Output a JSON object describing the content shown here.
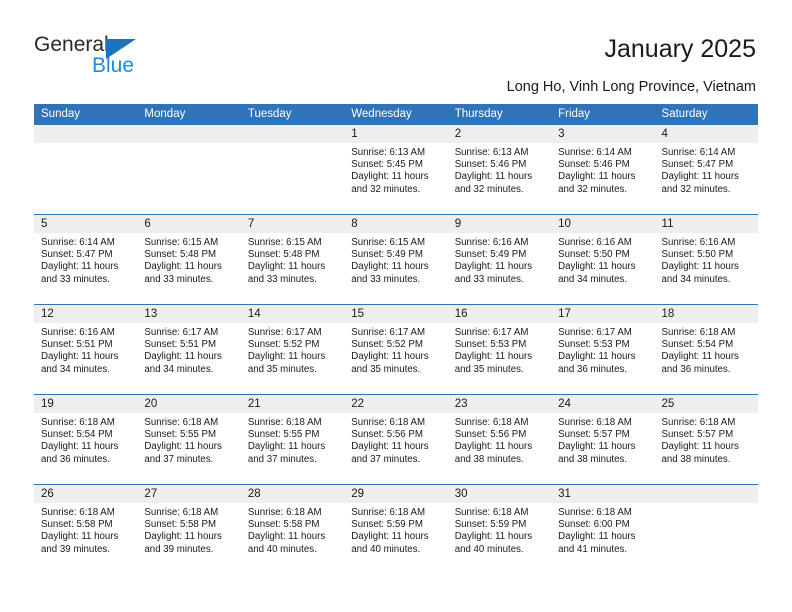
{
  "brand": {
    "name_part1": "General",
    "name_part2": "Blue",
    "triangle_color": "#1b74bb",
    "blue_color": "#1b8ae0"
  },
  "header": {
    "title": "January 2025",
    "subtitle": "Long Ho, Vinh Long Province, Vietnam",
    "accent_color": "#3073b8"
  },
  "calendar": {
    "weekday_headers": [
      "Sunday",
      "Monday",
      "Tuesday",
      "Wednesday",
      "Thursday",
      "Friday",
      "Saturday"
    ],
    "weeks": [
      [
        {
          "day": "",
          "lines": []
        },
        {
          "day": "",
          "lines": []
        },
        {
          "day": "",
          "lines": []
        },
        {
          "day": "1",
          "lines": [
            "Sunrise: 6:13 AM",
            "Sunset: 5:45 PM",
            "Daylight: 11 hours",
            "and 32 minutes."
          ]
        },
        {
          "day": "2",
          "lines": [
            "Sunrise: 6:13 AM",
            "Sunset: 5:46 PM",
            "Daylight: 11 hours",
            "and 32 minutes."
          ]
        },
        {
          "day": "3",
          "lines": [
            "Sunrise: 6:14 AM",
            "Sunset: 5:46 PM",
            "Daylight: 11 hours",
            "and 32 minutes."
          ]
        },
        {
          "day": "4",
          "lines": [
            "Sunrise: 6:14 AM",
            "Sunset: 5:47 PM",
            "Daylight: 11 hours",
            "and 32 minutes."
          ]
        }
      ],
      [
        {
          "day": "5",
          "lines": [
            "Sunrise: 6:14 AM",
            "Sunset: 5:47 PM",
            "Daylight: 11 hours",
            "and 33 minutes."
          ]
        },
        {
          "day": "6",
          "lines": [
            "Sunrise: 6:15 AM",
            "Sunset: 5:48 PM",
            "Daylight: 11 hours",
            "and 33 minutes."
          ]
        },
        {
          "day": "7",
          "lines": [
            "Sunrise: 6:15 AM",
            "Sunset: 5:48 PM",
            "Daylight: 11 hours",
            "and 33 minutes."
          ]
        },
        {
          "day": "8",
          "lines": [
            "Sunrise: 6:15 AM",
            "Sunset: 5:49 PM",
            "Daylight: 11 hours",
            "and 33 minutes."
          ]
        },
        {
          "day": "9",
          "lines": [
            "Sunrise: 6:16 AM",
            "Sunset: 5:49 PM",
            "Daylight: 11 hours",
            "and 33 minutes."
          ]
        },
        {
          "day": "10",
          "lines": [
            "Sunrise: 6:16 AM",
            "Sunset: 5:50 PM",
            "Daylight: 11 hours",
            "and 34 minutes."
          ]
        },
        {
          "day": "11",
          "lines": [
            "Sunrise: 6:16 AM",
            "Sunset: 5:50 PM",
            "Daylight: 11 hours",
            "and 34 minutes."
          ]
        }
      ],
      [
        {
          "day": "12",
          "lines": [
            "Sunrise: 6:16 AM",
            "Sunset: 5:51 PM",
            "Daylight: 11 hours",
            "and 34 minutes."
          ]
        },
        {
          "day": "13",
          "lines": [
            "Sunrise: 6:17 AM",
            "Sunset: 5:51 PM",
            "Daylight: 11 hours",
            "and 34 minutes."
          ]
        },
        {
          "day": "14",
          "lines": [
            "Sunrise: 6:17 AM",
            "Sunset: 5:52 PM",
            "Daylight: 11 hours",
            "and 35 minutes."
          ]
        },
        {
          "day": "15",
          "lines": [
            "Sunrise: 6:17 AM",
            "Sunset: 5:52 PM",
            "Daylight: 11 hours",
            "and 35 minutes."
          ]
        },
        {
          "day": "16",
          "lines": [
            "Sunrise: 6:17 AM",
            "Sunset: 5:53 PM",
            "Daylight: 11 hours",
            "and 35 minutes."
          ]
        },
        {
          "day": "17",
          "lines": [
            "Sunrise: 6:17 AM",
            "Sunset: 5:53 PM",
            "Daylight: 11 hours",
            "and 36 minutes."
          ]
        },
        {
          "day": "18",
          "lines": [
            "Sunrise: 6:18 AM",
            "Sunset: 5:54 PM",
            "Daylight: 11 hours",
            "and 36 minutes."
          ]
        }
      ],
      [
        {
          "day": "19",
          "lines": [
            "Sunrise: 6:18 AM",
            "Sunset: 5:54 PM",
            "Daylight: 11 hours",
            "and 36 minutes."
          ]
        },
        {
          "day": "20",
          "lines": [
            "Sunrise: 6:18 AM",
            "Sunset: 5:55 PM",
            "Daylight: 11 hours",
            "and 37 minutes."
          ]
        },
        {
          "day": "21",
          "lines": [
            "Sunrise: 6:18 AM",
            "Sunset: 5:55 PM",
            "Daylight: 11 hours",
            "and 37 minutes."
          ]
        },
        {
          "day": "22",
          "lines": [
            "Sunrise: 6:18 AM",
            "Sunset: 5:56 PM",
            "Daylight: 11 hours",
            "and 37 minutes."
          ]
        },
        {
          "day": "23",
          "lines": [
            "Sunrise: 6:18 AM",
            "Sunset: 5:56 PM",
            "Daylight: 11 hours",
            "and 38 minutes."
          ]
        },
        {
          "day": "24",
          "lines": [
            "Sunrise: 6:18 AM",
            "Sunset: 5:57 PM",
            "Daylight: 11 hours",
            "and 38 minutes."
          ]
        },
        {
          "day": "25",
          "lines": [
            "Sunrise: 6:18 AM",
            "Sunset: 5:57 PM",
            "Daylight: 11 hours",
            "and 38 minutes."
          ]
        }
      ],
      [
        {
          "day": "26",
          "lines": [
            "Sunrise: 6:18 AM",
            "Sunset: 5:58 PM",
            "Daylight: 11 hours",
            "and 39 minutes."
          ]
        },
        {
          "day": "27",
          "lines": [
            "Sunrise: 6:18 AM",
            "Sunset: 5:58 PM",
            "Daylight: 11 hours",
            "and 39 minutes."
          ]
        },
        {
          "day": "28",
          "lines": [
            "Sunrise: 6:18 AM",
            "Sunset: 5:58 PM",
            "Daylight: 11 hours",
            "and 40 minutes."
          ]
        },
        {
          "day": "29",
          "lines": [
            "Sunrise: 6:18 AM",
            "Sunset: 5:59 PM",
            "Daylight: 11 hours",
            "and 40 minutes."
          ]
        },
        {
          "day": "30",
          "lines": [
            "Sunrise: 6:18 AM",
            "Sunset: 5:59 PM",
            "Daylight: 11 hours",
            "and 40 minutes."
          ]
        },
        {
          "day": "31",
          "lines": [
            "Sunrise: 6:18 AM",
            "Sunset: 6:00 PM",
            "Daylight: 11 hours",
            "and 41 minutes."
          ]
        },
        {
          "day": "",
          "lines": []
        }
      ]
    ]
  }
}
